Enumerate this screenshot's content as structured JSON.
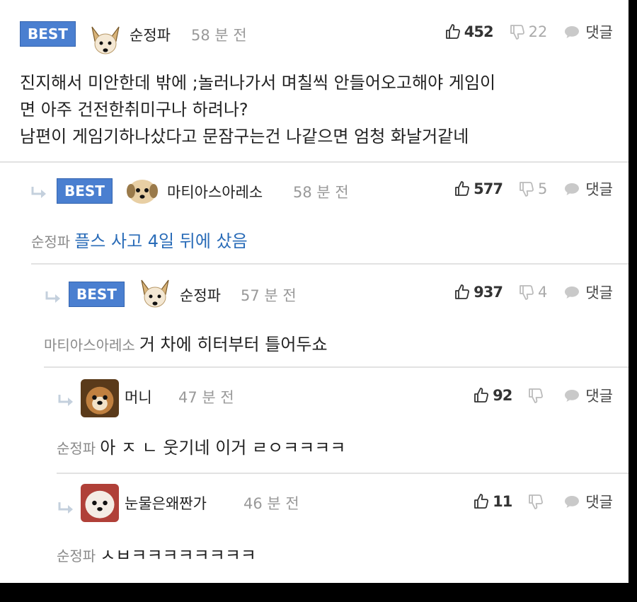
{
  "comments": [
    {
      "badge": "BEST",
      "author": "순정파",
      "time": "58 분 전",
      "likes": "452",
      "dislikes": "22",
      "reply_label": "댓글",
      "lines": [
        "진지해서 미안한데 밖에 ;놀러나가서 며칠씩 안들어오고해야 게임이",
        "면 아주 건전한취미구나 하려나?",
        "남편이 게임기하나샀다고 문잠구는건 나같으면 엄청 화날거같네"
      ]
    },
    {
      "badge": "BEST",
      "author": "마티아스아레소",
      "time": "58 분 전",
      "likes": "577",
      "dislikes": "5",
      "reply_label": "댓글",
      "mention": "순정파",
      "text": "플스 사고 4일 뒤에 샀음"
    },
    {
      "badge": "BEST",
      "author": "순정파",
      "time": "57 분 전",
      "likes": "937",
      "dislikes": "4",
      "reply_label": "댓글",
      "mention": "마티아스아레소",
      "text": "거 차에 히터부터 틀어두쇼"
    },
    {
      "author": "머니",
      "time": "47 분 전",
      "likes": "92",
      "dislikes": "",
      "reply_label": "댓글",
      "mention": "순정파",
      "text": "아 ㅈ ㄴ 웃기네 이거 ㄹㅇㅋㅋㅋㅋ"
    },
    {
      "author": "눈물은왜짠가",
      "time": "46 분 전",
      "likes": "11",
      "dislikes": "",
      "reply_label": "댓글",
      "mention": "순정파",
      "text": "ㅅㅂㅋㅋㅋㅋㅋㅋㅋㅋ"
    }
  ],
  "icons": {
    "like": "thumbs-up-icon",
    "dislike": "thumbs-down-icon",
    "reply": "speech-bubble-icon",
    "indent": "reply-arrow-icon"
  },
  "colors": {
    "badge": "#4a7fd0",
    "highlight_text": "#2a6cb8",
    "muted": "#999999"
  }
}
